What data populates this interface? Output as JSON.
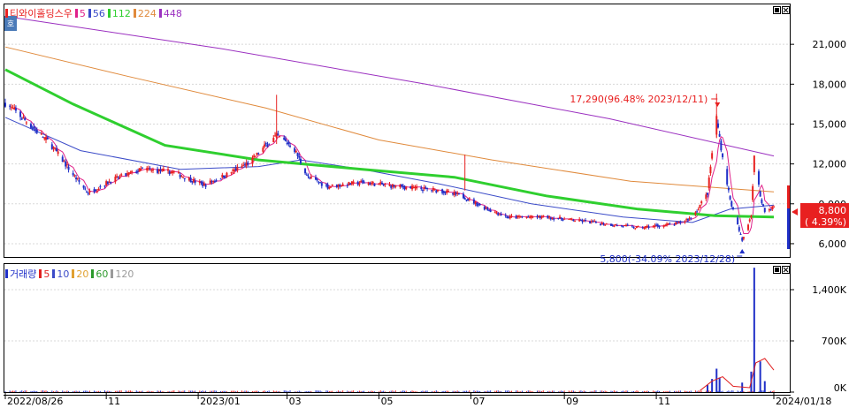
{
  "price_panel": {
    "legend_title": "티와이홀딩스우",
    "ma": [
      {
        "label": "5",
        "color": "#e0218a"
      },
      {
        "label": "56",
        "color": "#3b4bc8"
      },
      {
        "label": "112",
        "color": "#2fcf2f"
      },
      {
        "label": "224",
        "color": "#e08a3c"
      },
      {
        "label": "448",
        "color": "#9b30c0"
      }
    ],
    "price_box": {
      "value": "8,800",
      "change": "( 4.39%)"
    },
    "max_annotation": "17,290(96.48% 2023/12/11)",
    "min_annotation": "5,800(-34.09% 2023/12/28)"
  },
  "volume_panel": {
    "legend_title": "거래량",
    "ma": [
      {
        "label": "5",
        "color": "#e02020"
      },
      {
        "label": "10",
        "color": "#3b4bc8"
      },
      {
        "label": "20",
        "color": "#e0a030"
      },
      {
        "label": "60",
        "color": "#2c9a2c"
      },
      {
        "label": "120",
        "color": "#9a9a9a"
      }
    ]
  },
  "x_axis": {
    "labels": [
      "2022/08/26",
      "11",
      "2023/01",
      "03",
      "05",
      "07",
      "09",
      "11",
      "2024/01/18"
    ]
  },
  "colors": {
    "up": "#e82020",
    "down": "#2030c8",
    "border": "#000000",
    "grid": "#d8d8d8"
  },
  "chart_data": [
    {
      "type": "line",
      "title": "티와이홀딩스우",
      "ylim": [
        5000,
        24000
      ],
      "y_ticks": [
        6000,
        9000,
        12000,
        15000,
        18000,
        21000
      ],
      "y_tick_labels": [
        "6,000",
        "9,000",
        "12,000",
        "15,000",
        "18,000",
        "21,000"
      ],
      "x_range": [
        "2022/08/26",
        "2024/01/18"
      ],
      "price_nodes": [
        [
          "2022-08-26",
          16600
        ],
        [
          "2022-09-10",
          15100
        ],
        [
          "2022-09-25",
          13500
        ],
        [
          "2022-10-10",
          11200
        ],
        [
          "2022-10-20",
          9800
        ],
        [
          "2022-11-05",
          10800
        ],
        [
          "2022-11-25",
          11600
        ],
        [
          "2022-12-15",
          11400
        ],
        [
          "2023-01-05",
          10400
        ],
        [
          "2023-01-20",
          11200
        ],
        [
          "2023-02-05",
          12200
        ],
        [
          "2023-02-15",
          13400
        ],
        [
          "2023-02-22",
          14100
        ],
        [
          "2023-03-05",
          13300
        ],
        [
          "2023-03-15",
          11000
        ],
        [
          "2023-03-28",
          10300
        ],
        [
          "2023-04-20",
          10600
        ],
        [
          "2023-05-15",
          10300
        ],
        [
          "2023-06-10",
          10000
        ],
        [
          "2023-06-25",
          9600
        ],
        [
          "2023-07-10",
          8700
        ],
        [
          "2023-07-25",
          8000
        ],
        [
          "2023-08-20",
          8000
        ],
        [
          "2023-09-20",
          7600
        ],
        [
          "2023-10-20",
          7200
        ],
        [
          "2023-11-15",
          7500
        ],
        [
          "2023-11-25",
          8000
        ],
        [
          "2023-12-05",
          9800
        ],
        [
          "2023-12-08",
          12800
        ],
        [
          "2023-12-11",
          15500
        ],
        [
          "2023-12-15",
          12500
        ],
        [
          "2023-12-20",
          9300
        ],
        [
          "2023-12-28",
          6200
        ],
        [
          "2024-01-03",
          8200
        ],
        [
          "2024-01-05",
          12500
        ],
        [
          "2024-01-09",
          9600
        ],
        [
          "2024-01-12",
          8400
        ],
        [
          "2024-01-18",
          8800
        ]
      ],
      "series": [
        {
          "name": "5",
          "values": []
        },
        {
          "name": "56",
          "values": [
            [
              "2022-08-26",
              15500
            ],
            [
              "2022-10-15",
              13000
            ],
            [
              "2022-12-20",
              11600
            ],
            [
              "2023-02-10",
              11800
            ],
            [
              "2023-03-10",
              12300
            ],
            [
              "2023-04-20",
              11600
            ],
            [
              "2023-06-10",
              10500
            ],
            [
              "2023-08-10",
              9000
            ],
            [
              "2023-10-10",
              8000
            ],
            [
              "2023-11-25",
              7600
            ],
            [
              "2023-12-20",
              8600
            ],
            [
              "2024-01-18",
              8900
            ]
          ]
        },
        {
          "name": "112",
          "values": [
            [
              "2022-08-26",
              19100
            ],
            [
              "2022-10-10",
              16500
            ],
            [
              "2022-12-10",
              13400
            ],
            [
              "2023-02-10",
              12300
            ],
            [
              "2023-04-20",
              11600
            ],
            [
              "2023-06-20",
              11000
            ],
            [
              "2023-08-20",
              9600
            ],
            [
              "2023-10-20",
              8600
            ],
            [
              "2023-12-10",
              8100
            ],
            [
              "2024-01-18",
              8000
            ]
          ]
        },
        {
          "name": "224",
          "values": [
            [
              "2022-08-26",
              20800
            ],
            [
              "2022-11-15",
              18600
            ],
            [
              "2023-02-15",
              16200
            ],
            [
              "2023-05-01",
              13800
            ],
            [
              "2023-07-15",
              12300
            ],
            [
              "2023-10-15",
              10700
            ],
            [
              "2024-01-18",
              9900
            ]
          ]
        },
        {
          "name": "448",
          "values": [
            [
              "2022-08-26",
              23100
            ],
            [
              "2023-01-15",
              20700
            ],
            [
              "2023-06-01",
              18000
            ],
            [
              "2023-10-01",
              15400
            ],
            [
              "2024-01-18",
              12600
            ]
          ]
        }
      ]
    },
    {
      "type": "bar",
      "title": "거래량",
      "ylim": [
        0,
        1750000
      ],
      "y_ticks": [
        0,
        700000,
        1400000
      ],
      "y_tick_labels": [
        "0K",
        "700K",
        "1,400K"
      ],
      "spikes": [
        [
          "2023-12-05",
          100000
        ],
        [
          "2023-12-08",
          180000
        ],
        [
          "2023-12-11",
          320000
        ],
        [
          "2023-12-13",
          200000
        ],
        [
          "2023-12-28",
          130000
        ],
        [
          "2024-01-03",
          280000
        ],
        [
          "2024-01-05",
          1700000
        ],
        [
          "2024-01-09",
          420000
        ],
        [
          "2024-01-12",
          150000
        ]
      ],
      "series": [
        {
          "name": "5",
          "values": [
            [
              "2023-11-30",
              20000
            ],
            [
              "2023-12-08",
              150000
            ],
            [
              "2023-12-15",
              210000
            ],
            [
              "2023-12-22",
              80000
            ],
            [
              "2024-01-02",
              60000
            ],
            [
              "2024-01-06",
              400000
            ],
            [
              "2024-01-12",
              460000
            ],
            [
              "2024-01-18",
              300000
            ]
          ]
        }
      ]
    }
  ]
}
